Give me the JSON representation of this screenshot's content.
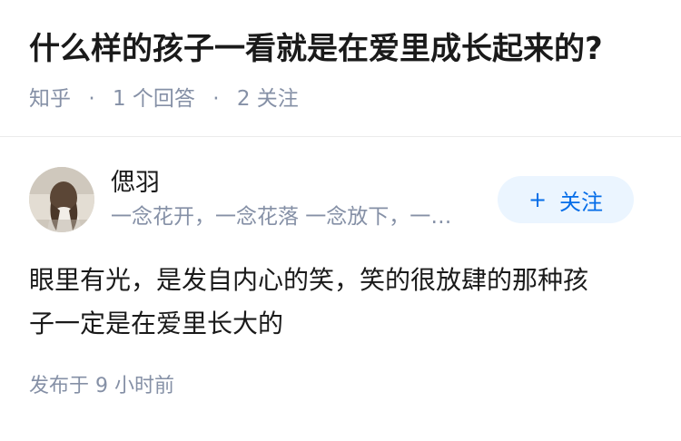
{
  "question": {
    "title": "什么样的孩子一看就是在爱里成长起来的?",
    "source": "知乎",
    "separator": "·",
    "answer_count": "1 个回答",
    "follow_count": "2 关注"
  },
  "answer": {
    "author_name": "偲羽",
    "author_bio": "一念花开，一念花落 一念放下，一念...",
    "follow_button": {
      "icon": "+",
      "label": "关注"
    },
    "content_line1": "眼里有光，是发自内心的笑，笑的很放肆的那种孩",
    "content_line2": "子一定是在爱里长大的",
    "time": "发布于 9 小时前"
  },
  "colors": {
    "meta": "#8590a6",
    "accent": "#056de8",
    "button_bg": "#ebf5ff"
  }
}
